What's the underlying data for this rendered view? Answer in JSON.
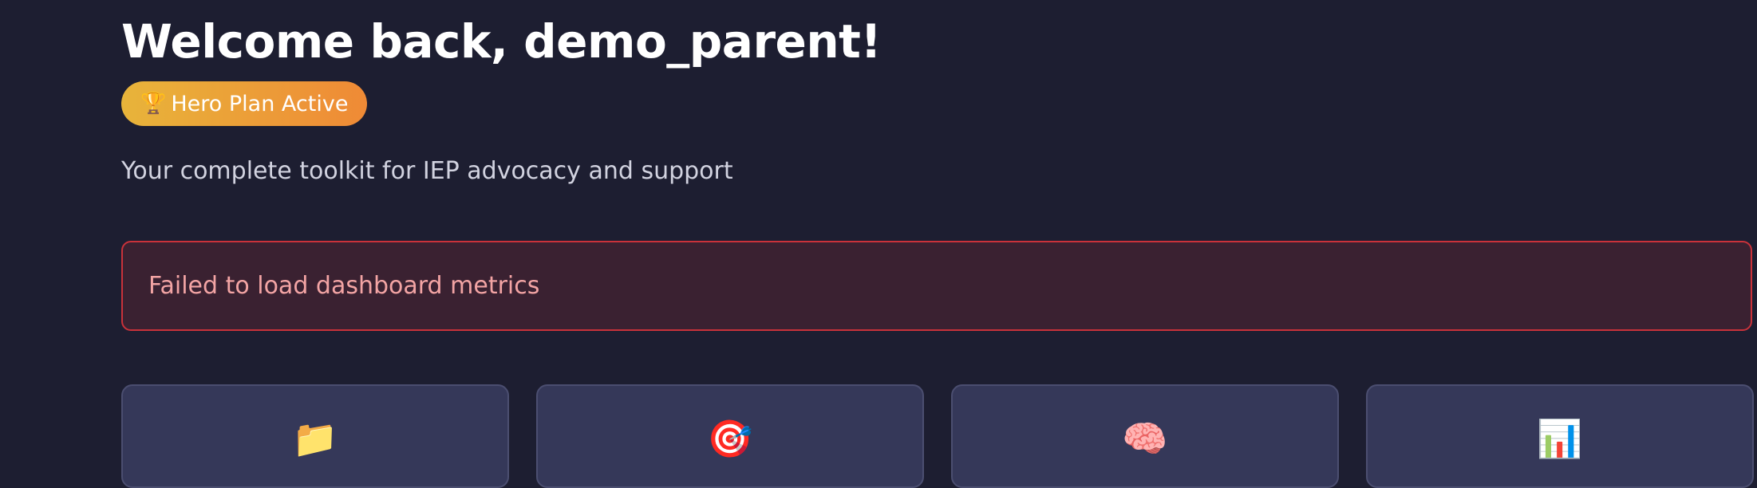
{
  "header": {
    "welcome": "Welcome back, demo_parent!",
    "plan_badge": {
      "icon": "trophy-icon",
      "glyph": "🏆",
      "label": "Hero Plan Active"
    },
    "subtitle": "Your complete toolkit for IEP advocacy and support"
  },
  "error": {
    "message": "Failed to load dashboard metrics"
  },
  "cards": [
    {
      "icon": "folder-icon",
      "glyph": "📁"
    },
    {
      "icon": "target-icon",
      "glyph": "🎯"
    },
    {
      "icon": "brain-icon",
      "glyph": "🧠"
    },
    {
      "icon": "bar-chart-icon",
      "glyph": "📊"
    }
  ],
  "colors": {
    "background": "#1d1e31",
    "badge_gradient_start": "#e8b43a",
    "badge_gradient_end": "#ef8a36",
    "error_border": "#c9323a",
    "error_background": "#3a2131",
    "error_text": "#f3a4a4",
    "card_background": "#353859"
  }
}
